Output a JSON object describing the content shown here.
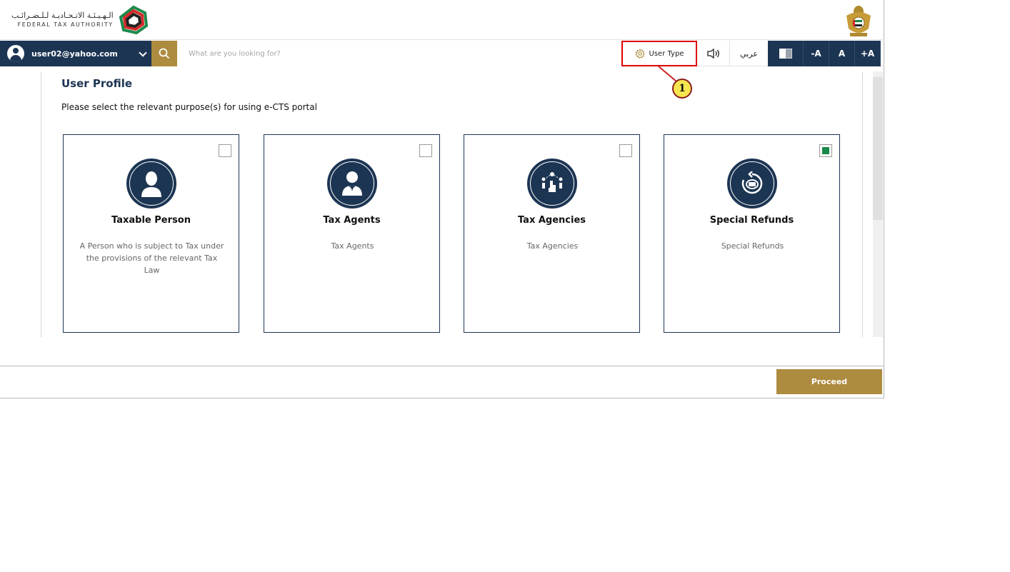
{
  "header": {
    "org_name_ar": "الـهـيـئـة الاتـحـاديـة لـلـضـرائـب",
    "org_name_en": "FEDERAL TAX AUTHORITY"
  },
  "nav": {
    "user_email": "user02@yahoo.com",
    "search_placeholder": "What are you looking for?",
    "user_type_label": "User Type",
    "arabic_label": "عربي",
    "font_decrease": "-A",
    "font_normal": "A",
    "font_increase": "+A"
  },
  "callout": {
    "number": "1"
  },
  "main": {
    "title": "User Profile",
    "subtitle": "Please select the relevant purpose(s) for using e-CTS portal",
    "cards": [
      {
        "title": "Taxable Person",
        "description": "A Person who is subject to Tax under the provisions of the relevant Tax Law",
        "checked": false,
        "icon": "person-icon"
      },
      {
        "title": "Tax Agents",
        "description": "Tax Agents",
        "checked": false,
        "icon": "agent-icon"
      },
      {
        "title": "Tax Agencies",
        "description": "Tax Agencies",
        "checked": false,
        "icon": "agency-icon"
      },
      {
        "title": "Special Refunds",
        "description": "Special Refunds",
        "checked": true,
        "icon": "refund-icon"
      }
    ]
  },
  "footer": {
    "proceed_label": "Proceed"
  },
  "colors": {
    "navy": "#1c3553",
    "gold": "#ad8b3f",
    "checked": "#1a8a4a",
    "highlight": "#e00000"
  }
}
